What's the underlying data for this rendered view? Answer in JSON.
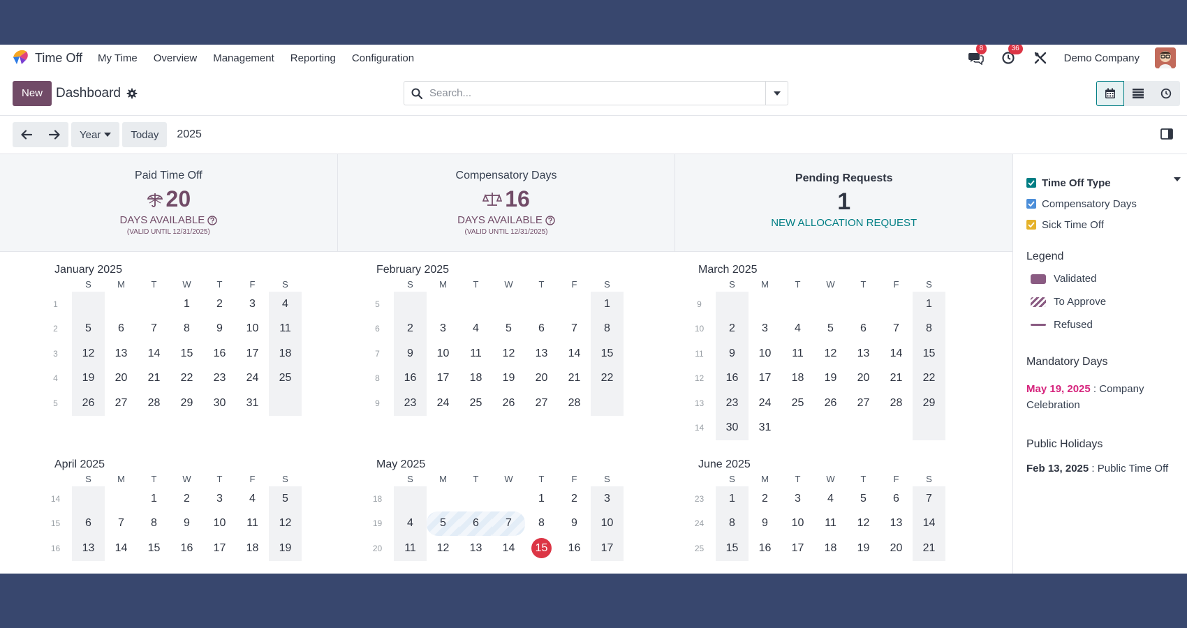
{
  "app": {
    "title": "Time Off",
    "menu": [
      "My Time",
      "Overview",
      "Management",
      "Reporting",
      "Configuration"
    ],
    "messages_count": "8",
    "activities_count": "36",
    "company": "Demo Company"
  },
  "control": {
    "new_label": "New",
    "title": "Dashboard",
    "search_placeholder": "Search..."
  },
  "datebar": {
    "scale": "Year",
    "today": "Today",
    "current": "2025"
  },
  "cards": {
    "paid": {
      "title": "Paid Time Off",
      "value": "20",
      "sub": "DAYS AVAILABLE",
      "valid": "(VALID UNTIL 12/31/2025)"
    },
    "comp": {
      "title": "Compensatory Days",
      "value": "16",
      "sub": "DAYS AVAILABLE",
      "valid": "(VALID UNTIL 12/31/2025)"
    },
    "pending": {
      "title": "Pending Requests",
      "value": "1",
      "link": "NEW ALLOCATION REQUEST"
    }
  },
  "weekdays": [
    "S",
    "M",
    "T",
    "W",
    "T",
    "F",
    "S"
  ],
  "months": [
    {
      "title": "January 2025",
      "start": 3,
      "days": 31,
      "first_week": 1
    },
    {
      "title": "February 2025",
      "start": 6,
      "days": 28,
      "first_week": 5
    },
    {
      "title": "March 2025",
      "start": 6,
      "days": 31,
      "first_week": 9
    },
    {
      "title": "April 2025",
      "start": 2,
      "days": 30,
      "first_week": 14,
      "rows": 3
    },
    {
      "title": "May 2025",
      "start": 4,
      "days": 31,
      "first_week": 18,
      "rows": 3,
      "today": 15,
      "to_approve": [
        5,
        6,
        7
      ]
    },
    {
      "title": "June 2025",
      "start": 0,
      "days": 30,
      "first_week": 23,
      "rows": 3
    }
  ],
  "side": {
    "filter_title": "Time Off Type",
    "filters": [
      {
        "label": "Compensatory Days",
        "color": "#4c8ed9"
      },
      {
        "label": "Sick Time Off",
        "color": "#e5b22a"
      }
    ],
    "filter_head_color": "#017e84",
    "legend_title": "Legend",
    "legend": [
      "Validated",
      "To Approve",
      "Refused"
    ],
    "mandatory_title": "Mandatory Days",
    "mandatory_date": "May 19, 2025",
    "mandatory_text": " : Company Celebration",
    "holidays_title": "Public Holidays",
    "holiday_date": "Feb 13, 2025",
    "holiday_text": " : Public Time Off"
  },
  "colors": {
    "brand": "#714b67",
    "accent": "#017e84",
    "today": "#dc3545",
    "mandatory": "#d6247d"
  }
}
